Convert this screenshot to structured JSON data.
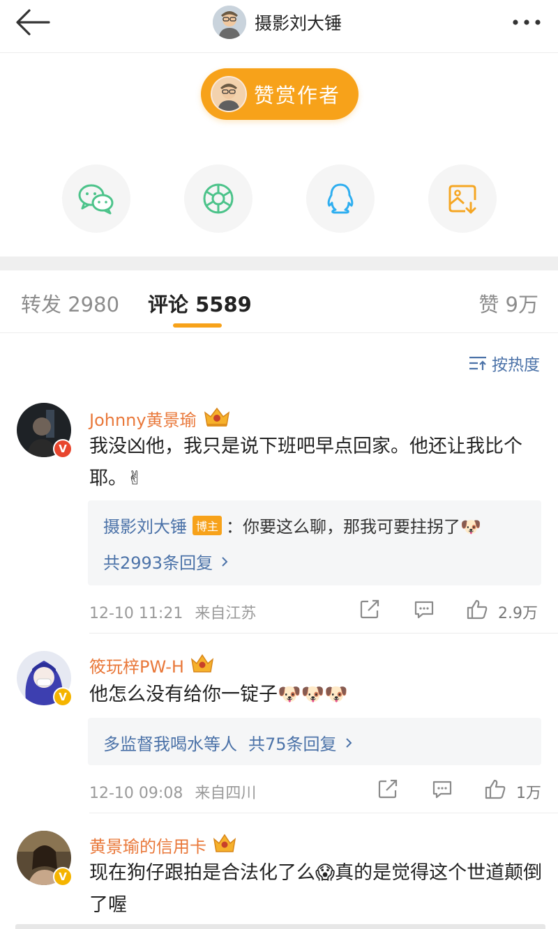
{
  "header": {
    "title": "摄影刘大锤"
  },
  "reward": {
    "label": "赞赏作者"
  },
  "tabs": {
    "repost": "转发 2980",
    "comment": "评论 5589",
    "like": "赞 9万"
  },
  "sort": {
    "label": "按热度"
  },
  "comments": [
    {
      "name": "Johnny黄景瑜",
      "text": "我没凶他，我只是说下班吧早点回家。他还让我比个耶。✌",
      "reply": {
        "author": "摄影刘大锤",
        "tag": "博主",
        "text": "：你要这么聊，那我可要拄拐了🐶",
        "total": "共2993条回复"
      },
      "time": "12-10 11:21",
      "location": "来自江苏",
      "likes": "2.9万"
    },
    {
      "name": "筱玩梓PW-H",
      "text": "他怎么没有给你一锭子🐶🐶🐶",
      "reply": {
        "preview": "多监督我喝水等人",
        "total": "共75条回复"
      },
      "time": "12-10 09:08",
      "location": "来自四川",
      "likes": "1万"
    },
    {
      "name": "黄景瑜的信用卡",
      "text": "现在狗仔跟拍是合法化了么😱真的是觉得这个世道颠倒了喔"
    }
  ]
}
